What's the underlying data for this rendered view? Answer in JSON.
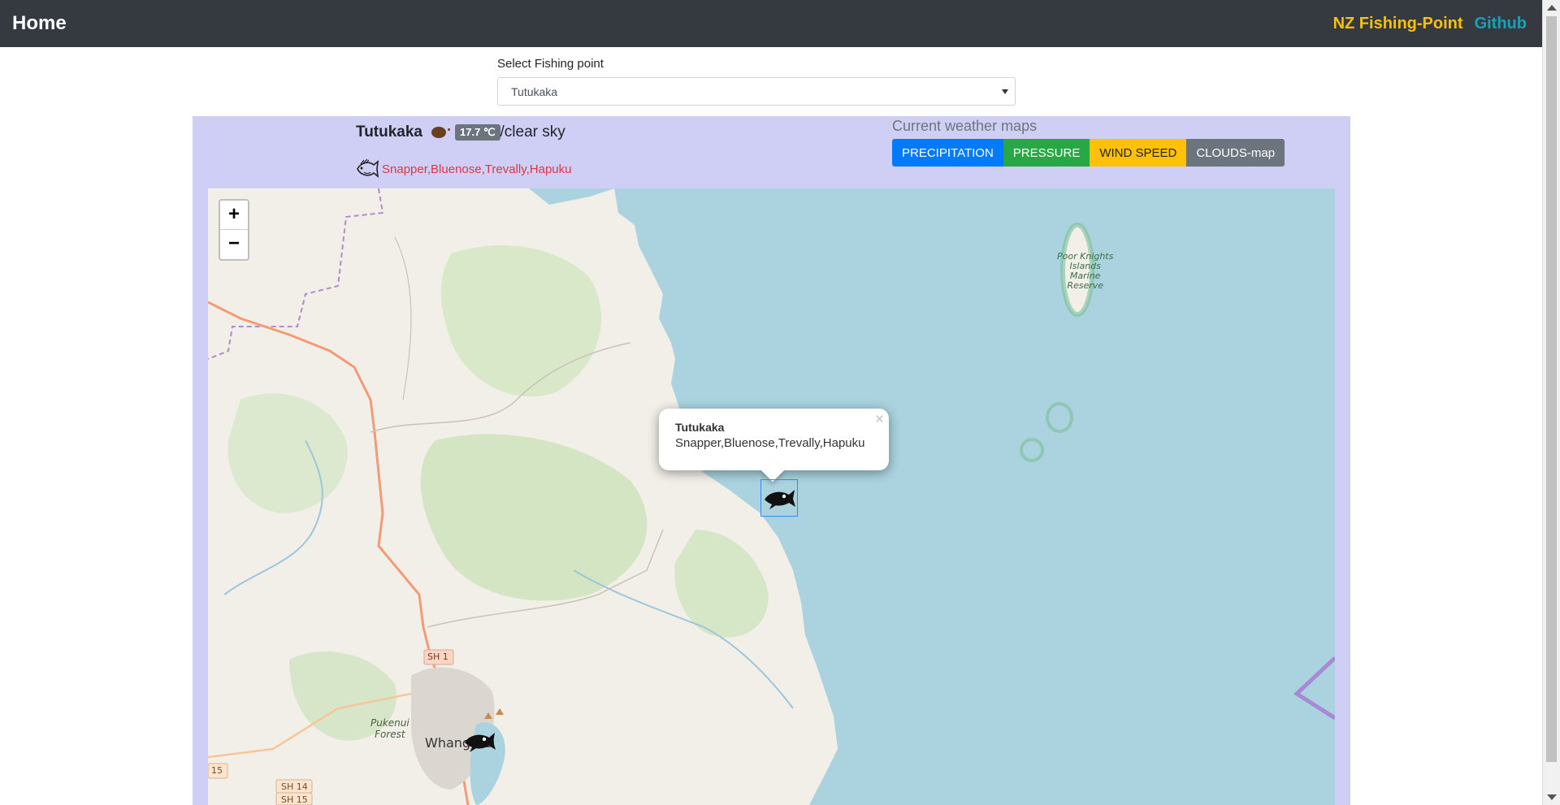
{
  "navbar": {
    "brand": "Home",
    "site_name": "NZ Fishing-Point",
    "github": "Github"
  },
  "select": {
    "label": "Select Fishing point",
    "value": "Tutukaka"
  },
  "spot": {
    "name": "Tutukaka",
    "temperature": "17.7 ℃",
    "sky": "/clear sky",
    "species": "Snapper,Bluenose,Trevally,Hapuku"
  },
  "weather_maps": {
    "title": "Current weather maps",
    "buttons": [
      "PRECIPITATION",
      "PRESSURE",
      "WIND SPEED",
      "CLOUDS-map"
    ]
  },
  "map": {
    "zoom_in": "+",
    "zoom_out": "−",
    "popup": {
      "title": "Tutukaka",
      "species": "Snapper,Bluenose,Trevally,Hapuku",
      "close": "×"
    },
    "labels": {
      "poor_knights": [
        "Poor Knights",
        "Islands",
        "Marine",
        "Reserve"
      ],
      "sh1": "SH 1",
      "pukenui": [
        "Pukenui",
        "Forest"
      ],
      "whangarei": "Whangarei",
      "r15": "15",
      "sh14": "SH 14",
      "sh15": "SH 15"
    }
  },
  "colors": {
    "navbar": "#343a40",
    "panel": "#cfcff5",
    "sea": "#aad3df",
    "land": "#f2efe9",
    "species": "#dc3545"
  }
}
